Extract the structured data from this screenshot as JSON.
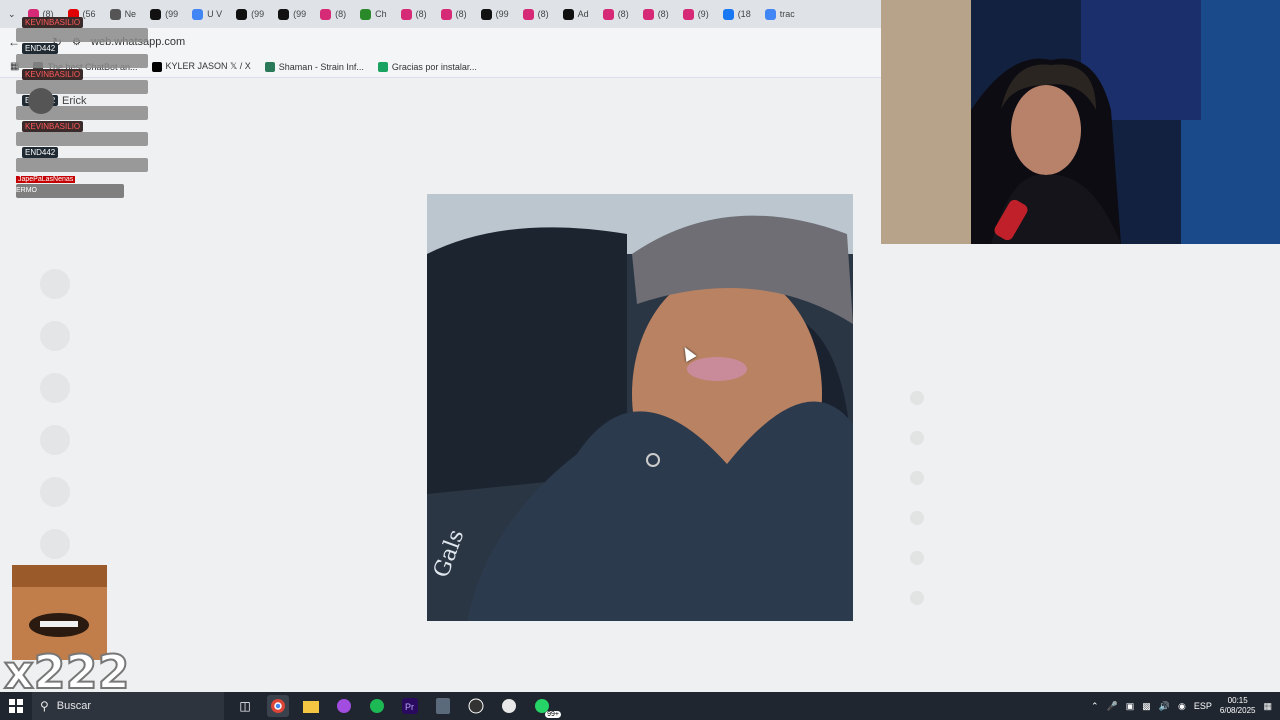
{
  "browser": {
    "tabs": [
      {
        "label": "(8)",
        "color": "#d62976"
      },
      {
        "label": "(56",
        "color": "#e00000"
      },
      {
        "label": "Ne",
        "color": "#555555"
      },
      {
        "label": "(99",
        "color": "#111111"
      },
      {
        "label": "U V",
        "color": "#4285f4"
      },
      {
        "label": "(99",
        "color": "#111111"
      },
      {
        "label": "(99",
        "color": "#111111"
      },
      {
        "label": "(8)",
        "color": "#d62976"
      },
      {
        "label": "Ch",
        "color": "#2a8a2a"
      },
      {
        "label": "(8)",
        "color": "#d62976"
      },
      {
        "label": "(8)",
        "color": "#d62976"
      },
      {
        "label": "(99",
        "color": "#111111"
      },
      {
        "label": "(8)",
        "color": "#d62976"
      },
      {
        "label": "Ad",
        "color": "#111111"
      },
      {
        "label": "(8)",
        "color": "#d62976"
      },
      {
        "label": "(8)",
        "color": "#d62976"
      },
      {
        "label": "(9)",
        "color": "#d62976"
      },
      {
        "label": "(18",
        "color": "#1877f2"
      },
      {
        "label": "trac",
        "color": "#4285f4"
      }
    ],
    "url": "web.whatsapp.com",
    "bookmarks": [
      {
        "label": "The best ChatBot an...",
        "color": "#444444"
      },
      {
        "label": "KYLER JASON 𝕏 / X",
        "color": "#000000"
      },
      {
        "label": "Shaman - Strain Inf...",
        "color": "#2a7a5a"
      },
      {
        "label": "Gracias por instalar...",
        "color": "#1aa260"
      }
    ]
  },
  "stream_chat": {
    "users": [
      {
        "name": "KEVINBASILIO",
        "style": "red"
      },
      {
        "name": "END442",
        "style": "dark"
      },
      {
        "name": "KEVINBASILIO",
        "style": "red"
      },
      {
        "name": "END442",
        "style": "dark"
      },
      {
        "name": "KEVINBASILIO",
        "style": "red"
      },
      {
        "name": "END442",
        "style": "dark"
      }
    ],
    "last_tag": "JapePaLasNenas",
    "last_text": "ERMO"
  },
  "whatsapp": {
    "contact_name": "Erick"
  },
  "emote": {
    "count": "x222"
  },
  "taskbar": {
    "search_label": "Buscar",
    "whatsapp_badge": "99+",
    "language": "ESP",
    "time": "00:15",
    "date": "6/08/2025"
  }
}
